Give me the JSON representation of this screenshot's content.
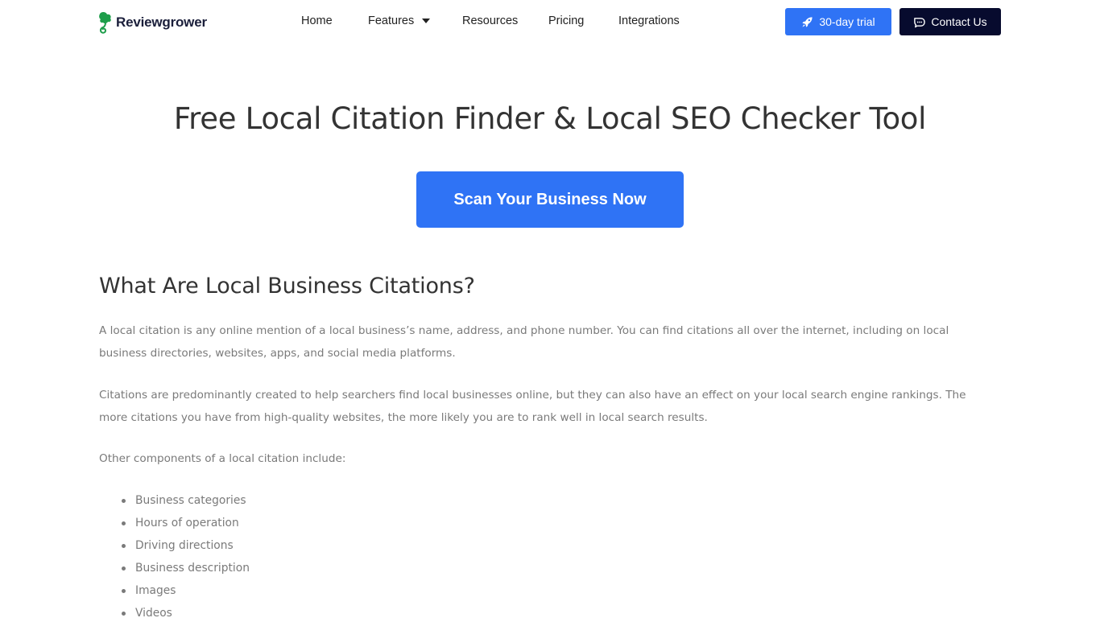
{
  "header": {
    "logo_text": "Reviewgrower",
    "nav": [
      {
        "label": "Home",
        "has_dropdown": false
      },
      {
        "label": "Features",
        "has_dropdown": true
      },
      {
        "label": "Resources",
        "has_dropdown": false
      },
      {
        "label": "Pricing",
        "has_dropdown": false
      },
      {
        "label": "Integrations",
        "has_dropdown": false
      }
    ],
    "trial_button": {
      "label": "30-day trial",
      "icon": "rocket-icon"
    },
    "contact_button": {
      "label": "Contact Us",
      "icon": "chat-bubble-icon"
    }
  },
  "colors": {
    "primary_blue": "#2f73f5",
    "dark_navy": "#070b2e",
    "logo_green": "#1e9e4b",
    "body_text": "#7a7a7a",
    "heading_text": "#333333"
  },
  "hero": {
    "title": "Free Local Citation Finder & Local SEO Checker Tool",
    "cta_label": "Scan Your Business Now"
  },
  "content": {
    "section_title": "What Are Local Business Citations?",
    "paragraphs": [
      "A local citation is any online mention of a local business’s name, address, and phone number. You can find citations all over the internet, including on local business directories, websites, apps, and social media platforms.",
      "Citations are predominantly created to help searchers find local businesses online, but they can also have an effect on your local search engine rankings. The more citations you have from high-quality websites, the more likely you are to rank well in local search results.",
      "Other components of a local citation include:"
    ],
    "components": [
      "Business categories",
      "Hours of operation",
      "Driving directions",
      "Business description",
      "Images",
      "Videos"
    ]
  }
}
